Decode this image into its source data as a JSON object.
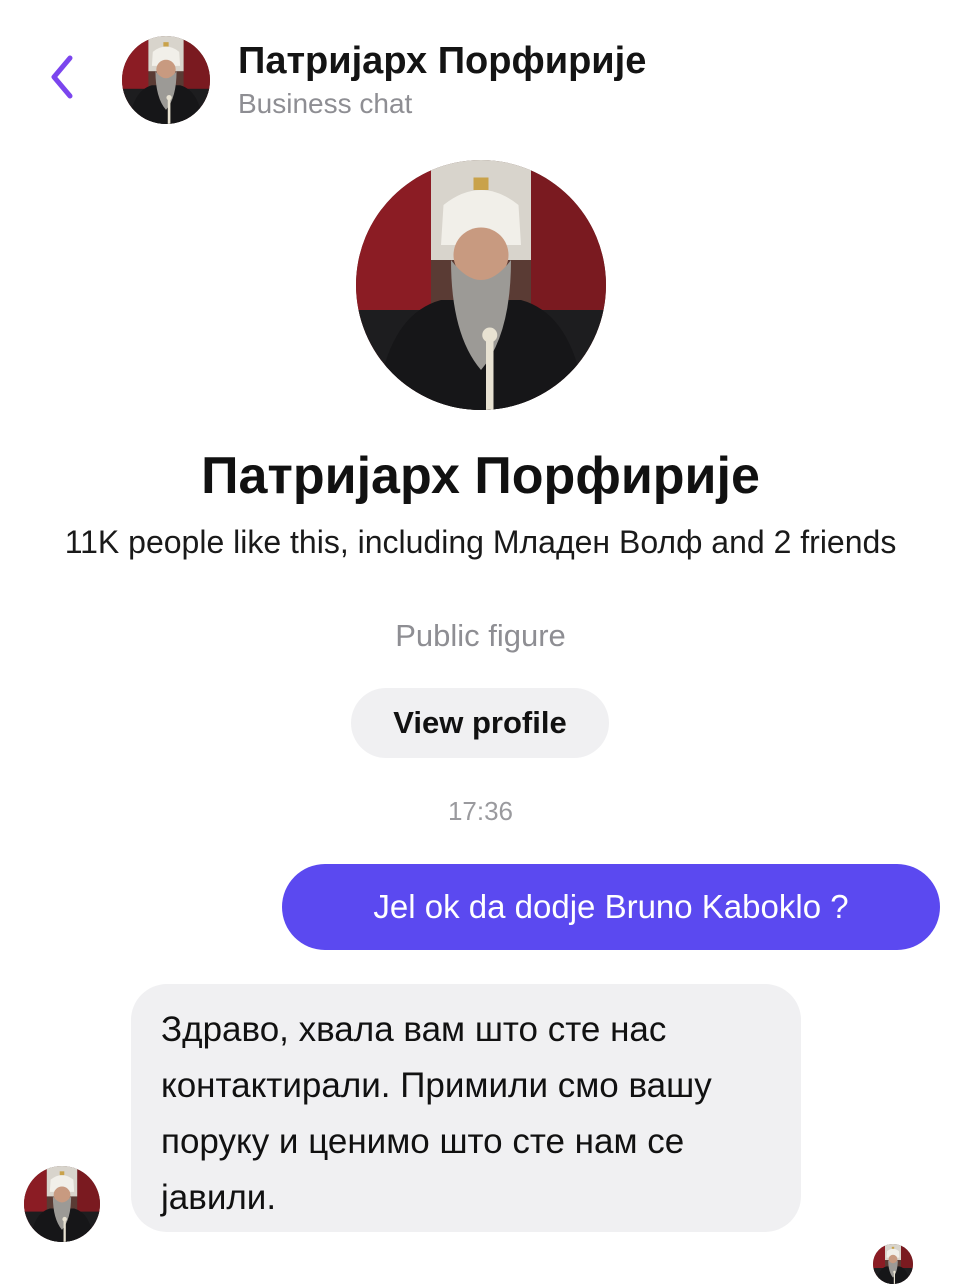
{
  "header": {
    "back_icon": "chevron-left-icon",
    "name": "Патријарх Порфирије",
    "subtitle": "Business chat"
  },
  "profile": {
    "name": "Патријарх Порфирије",
    "likes_text": "11K people like this, including Младен Волф and 2 friends",
    "category": "Public figure",
    "view_profile_label": "View profile"
  },
  "conversation": {
    "timestamp": "17:36",
    "messages": [
      {
        "direction": "outgoing",
        "text": "Jel ok da dodje Bruno Kaboklo ?"
      },
      {
        "direction": "incoming",
        "text": "Здраво, хвала вам што сте нас контактирали. Примили смо вашу поруку и ценимо што сте нам се јавили."
      }
    ]
  },
  "colors": {
    "accent": "#5b49f0",
    "back_chevron": "#7b45ee",
    "incoming_bubble": "#f0f0f2",
    "secondary_text": "#8e8e93"
  }
}
